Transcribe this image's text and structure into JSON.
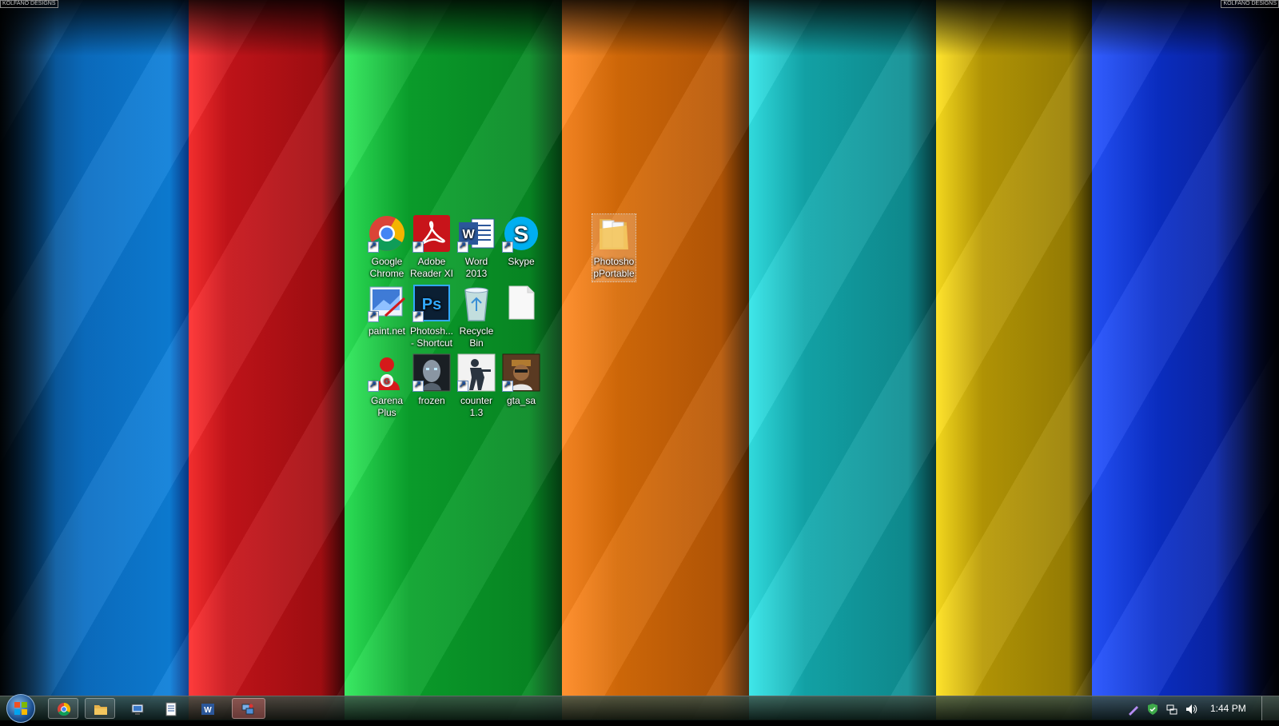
{
  "watermark": {
    "left": "KOLFANO DESIGNS",
    "right": "KOLFANO DESIGNS"
  },
  "wallpaper_colors": [
    "#0b6fc4",
    "#c8141a",
    "#0aa32c",
    "#d86c08",
    "#13a9ad",
    "#b99a05",
    "#0b2fc9"
  ],
  "desktop_icons": [
    {
      "label": "Google Chrome",
      "icon": "chrome-icon"
    },
    {
      "label": "Adobe Reader XI",
      "icon": "adobe-reader-icon"
    },
    {
      "label": "Word 2013",
      "icon": "word-icon"
    },
    {
      "label": "Skype",
      "icon": "skype-icon"
    },
    {
      "label": "paint.net",
      "icon": "paintnet-icon"
    },
    {
      "label": "Photosh... - Shortcut",
      "icon": "photoshop-icon"
    },
    {
      "label": "Recycle Bin",
      "icon": "recycle-bin-icon"
    },
    {
      "label": "",
      "icon": "blank-file-icon"
    },
    {
      "label": "Garena Plus",
      "icon": "garena-icon"
    },
    {
      "label": "frozen",
      "icon": "frozen-icon"
    },
    {
      "label": "counter 1.3",
      "icon": "counter-strike-icon"
    },
    {
      "label": "gta_sa",
      "icon": "gta-sa-icon"
    },
    {
      "label": "PhotoshopPortable",
      "icon": "folder-icon",
      "selected": true
    }
  ],
  "taskbar": {
    "start_icon": "windows-logo-icon",
    "buttons": [
      {
        "name": "chrome",
        "icon": "chrome-icon"
      },
      {
        "name": "file-explorer",
        "icon": "folder-icon"
      },
      {
        "name": "computer",
        "icon": "computer-icon"
      },
      {
        "name": "document",
        "icon": "document-icon"
      },
      {
        "name": "word",
        "icon": "word-icon"
      },
      {
        "name": "network-tool",
        "icon": "network-icon",
        "active": true
      }
    ],
    "tray": [
      "pen-icon",
      "security-shield-icon",
      "network-status-icon",
      "volume-icon"
    ],
    "clock": "1:44 PM"
  }
}
